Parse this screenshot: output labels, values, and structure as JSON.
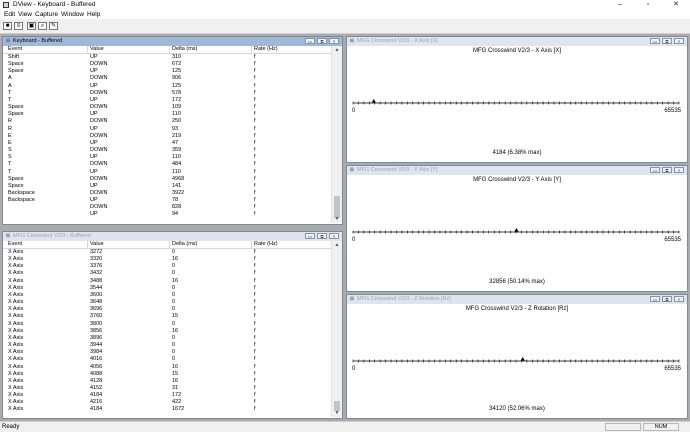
{
  "app": {
    "title": "DView - Keyboard - Buffered"
  },
  "window_buttons": {
    "minimize": "–",
    "maximize": "▫",
    "close": "✕"
  },
  "menu": [
    "Edit",
    "View",
    "Capture",
    "Window",
    "Help"
  ],
  "toolbar": {
    "buttons": [
      {
        "name": "save",
        "glyph": "■"
      },
      {
        "name": "properties",
        "glyph": "≡"
      },
      {
        "name": "lock",
        "glyph": "▣"
      },
      {
        "name": "zoom",
        "glyph": "⌕"
      },
      {
        "name": "edit",
        "glyph": "✎"
      }
    ]
  },
  "child_caption_buttons": {
    "minimize": "▭",
    "restore": "⧉",
    "close": "×"
  },
  "keyboard_panel": {
    "title": "Keyboard - Buffered",
    "columns": [
      "Event",
      "Value",
      "Delta (ms)",
      "Rate (Hz)"
    ],
    "rows": [
      [
        "Shift",
        "UP",
        "310",
        "f"
      ],
      [
        "Space",
        "DOWN",
        "672",
        "f"
      ],
      [
        "Space",
        "UP",
        "125",
        "f"
      ],
      [
        "A",
        "DOWN",
        "906",
        "f"
      ],
      [
        "A",
        "UP",
        "125",
        "f"
      ],
      [
        "T",
        "DOWN",
        "578",
        "f"
      ],
      [
        "T",
        "UP",
        "172",
        "f"
      ],
      [
        "Space",
        "DOWN",
        "109",
        "f"
      ],
      [
        "Space",
        "UP",
        "110",
        "f"
      ],
      [
        "R",
        "DOWN",
        "250",
        "f"
      ],
      [
        "R",
        "UP",
        "93",
        "f"
      ],
      [
        "E",
        "DOWN",
        "219",
        "f"
      ],
      [
        "E",
        "UP",
        "47",
        "f"
      ],
      [
        "S",
        "DOWN",
        "359",
        "f"
      ],
      [
        "S",
        "UP",
        "110",
        "f"
      ],
      [
        "T",
        "DOWN",
        "484",
        "f"
      ],
      [
        "T",
        "UP",
        "110",
        "f"
      ],
      [
        "Space",
        "DOWN",
        "4968",
        "f"
      ],
      [
        "Space",
        "UP",
        "141",
        "f"
      ],
      [
        "Backspace",
        "DOWN",
        "3922",
        "f"
      ],
      [
        "Backspace",
        "UP",
        "78",
        "f"
      ],
      [
        "",
        "DOWN",
        "828",
        "f"
      ],
      [
        "",
        "UP",
        "94",
        "f"
      ]
    ]
  },
  "joystick_panel": {
    "title": "MFG Crosswind V2/3 - Buffered",
    "columns": [
      "Event",
      "Value",
      "Delta (ms)",
      "Rate (Hz)"
    ],
    "rows": [
      [
        "X Axis",
        "3272",
        "0",
        "f"
      ],
      [
        "X Axis",
        "3320",
        "16",
        "f"
      ],
      [
        "X Axis",
        "3376",
        "0",
        "f"
      ],
      [
        "X Axis",
        "3432",
        "0",
        "f"
      ],
      [
        "X Axis",
        "3488",
        "16",
        "f"
      ],
      [
        "X Axis",
        "3544",
        "0",
        "f"
      ],
      [
        "X Axis",
        "3600",
        "0",
        "f"
      ],
      [
        "X Axis",
        "3648",
        "0",
        "f"
      ],
      [
        "X Axis",
        "3696",
        "0",
        "f"
      ],
      [
        "X Axis",
        "3760",
        "15",
        "f"
      ],
      [
        "X Axis",
        "3800",
        "0",
        "f"
      ],
      [
        "X Axis",
        "3856",
        "16",
        "f"
      ],
      [
        "X Axis",
        "3896",
        "0",
        "f"
      ],
      [
        "X Axis",
        "3944",
        "0",
        "f"
      ],
      [
        "X Axis",
        "3984",
        "0",
        "f"
      ],
      [
        "X Axis",
        "4016",
        "0",
        "f"
      ],
      [
        "X Axis",
        "4056",
        "16",
        "f"
      ],
      [
        "X Axis",
        "4088",
        "15",
        "f"
      ],
      [
        "X Axis",
        "4128",
        "16",
        "f"
      ],
      [
        "X Axis",
        "4152",
        "31",
        "f"
      ],
      [
        "X Axis",
        "4184",
        "172",
        "f"
      ],
      [
        "X Axis",
        "4216",
        "422",
        "f"
      ],
      [
        "X Axis",
        "4184",
        "1672",
        "f"
      ]
    ]
  },
  "axis_panels": [
    {
      "window_title": "MFG Crosswind V2/3 - X Axis [X]",
      "plot_title": "MFG Crosswind V2/3 - X Axis [X]",
      "min_label": "0",
      "max_label": "65535",
      "value": 4184,
      "max": 65535,
      "readout": "4184 (6.38% max)"
    },
    {
      "window_title": "MFG Crosswind V2/3 - Y Axis [Y]",
      "plot_title": "MFG Crosswind V2/3 - Y Axis [Y]",
      "min_label": "0",
      "max_label": "65535",
      "value": 32856,
      "max": 65535,
      "readout": "32856 (50.14% max)"
    },
    {
      "window_title": "MFG Crosswind V2/3 - Z Rotation [Rz]",
      "plot_title": "MFG Crosswind V2/3 - Z Rotation [Rz]",
      "min_label": "0",
      "max_label": "65535",
      "value": 34120,
      "max": 65535,
      "readout": "34120 (52.06% max)"
    }
  ],
  "status": {
    "text": "Ready",
    "num": "NUM"
  },
  "colors": {
    "active_caption": "#9fb8d8",
    "inactive_caption": "#dfe5ee",
    "mdi_background": "#ababab"
  }
}
